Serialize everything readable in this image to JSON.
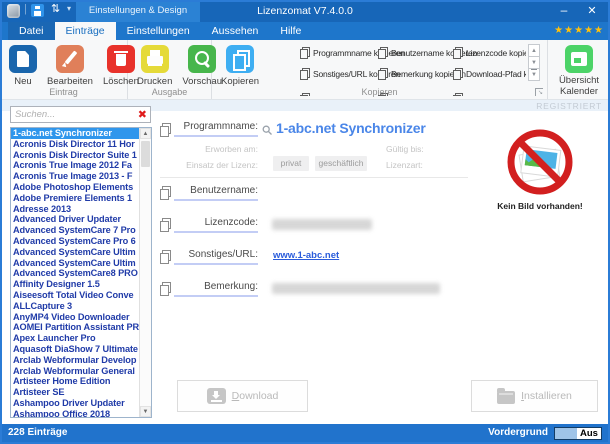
{
  "titlebar": {
    "qat_group": "Einstellungen & Design",
    "title": "Lizenzomat V7.4.0.0",
    "minimize_glyph": "–",
    "close_glyph": "✕",
    "qat_caret_glyph": "▾",
    "updown_glyph": "⇅",
    "separator_glyph": "|"
  },
  "tabs": {
    "items": [
      "Datei",
      "Einträge",
      "Einstellungen",
      "Aussehen",
      "Hilfe"
    ],
    "active": "Einträge"
  },
  "rating": {
    "stars_glyphs": "★★★★★",
    "count": 5
  },
  "registered_badge": "REGISTRIERT",
  "ribbon": {
    "eintrag": {
      "group_label": "Eintrag",
      "neu": "Neu",
      "bearbeiten": "Bearbeiten",
      "loeschen": "Löschen"
    },
    "ausgabe": {
      "group_label": "Ausgabe",
      "drucken": "Drucken",
      "vorschau": "Vorschau"
    },
    "kopieren": {
      "group_label": "Kopieren",
      "button": "Kopieren",
      "items": [
        "Programmname kopieren",
        "Benutzername kopieren",
        "Lizenzcode kopieren",
        "Sonstiges/URL kopieren",
        "Bemerkung kopieren",
        "Download-Pfad kopieren"
      ],
      "scroll_up_glyph": "▲",
      "scroll_down_glyph": "▼",
      "more_glyph": "▼",
      "launcher_glyph": "↘"
    },
    "kalender": {
      "line1": "Übersicht",
      "line2": "Kalender"
    }
  },
  "sidebar": {
    "search_placeholder": "Suchen...",
    "clear_glyph": "✖",
    "scroll_up_glyph": "▲",
    "scroll_down_glyph": "▼",
    "selected_index": 0,
    "items": [
      "1-abc.net Synchronizer",
      "Acronis Disk Director 11 Hor",
      "Acronis Disk Director Suite 1",
      "Acronis True Image 2012 Fa",
      "Acronis True Image 2013 - F",
      "Adobe Photoshop Elements",
      "Adobe Premiere Elements 1",
      "Adresse 2013",
      "Advanced Driver Updater",
      "Advanced SystemCare 7 Pro",
      "Advanced SystemCare Pro 6",
      "Advanced SystemCare Ultim",
      "Advanced SystemCare Ultim",
      "Advanced SystemCare8 PRO",
      "Affinity Designer 1.5",
      "Aiseesoft Total Video Conve",
      "ALLCapture 3",
      "AnyMP4 Video Downloader",
      "AOMEI Partition Assistant PR",
      "Apex Launcher Pro",
      "Aquasoft DiaShow 7 Ultimate",
      "Arclab Webformular Develop",
      "Arclab Webformular General",
      "Artisteer Home Edition",
      "Artisteer SE",
      "Ashampoo Driver Updater",
      "Ashampoo Office 2018"
    ]
  },
  "main": {
    "programmname": {
      "label": "Programmname:",
      "value": "1-abc.net Synchronizer"
    },
    "meta": {
      "erworben_am": "Erworben am:",
      "gueltig_bis": "Gültig bis:",
      "einsatz_der_lizenz": "Einsatz der Lizenz:",
      "privat": "privat",
      "geschaeftlich": "geschäftlich",
      "lizenzart": "Lizenzart:"
    },
    "benutzername": {
      "label": "Benutzername:"
    },
    "lizenzcode": {
      "label": "Lizenzcode:",
      "value_redacted": true
    },
    "sonstiges_url": {
      "label": "Sonstiges/URL:",
      "value": "www.1-abc.net"
    },
    "bemerkung": {
      "label": "Bemerkung:",
      "value_redacted": true
    },
    "no_image_text": "Kein Bild vorhanden!",
    "download_button": "Download",
    "install_button": "Installieren"
  },
  "statusbar": {
    "entries": "228 Einträge",
    "vordergrund": "Vordergrund",
    "toggle_state": "Aus"
  },
  "colors": {
    "titlebar": "#1766b8",
    "tabrow": "#1e76cb",
    "statusbar": "#2173cc",
    "window_border": "#2b7cd6",
    "selection_blue": "#2f96ec",
    "accent_value_blue": "#4a86e8",
    "star_gold": "#ffc10d",
    "neu_icon": "#1a66ad",
    "bearbeiten_icon": "#e07f5a",
    "loeschen_icon": "#e8322b",
    "drucken_icon": "#e5da39",
    "vorschau_icon": "#47b64c",
    "kopieren_icon": "#3eaef2",
    "kalender_icon": "#4cd368",
    "no_image_red": "#d21f1f"
  }
}
